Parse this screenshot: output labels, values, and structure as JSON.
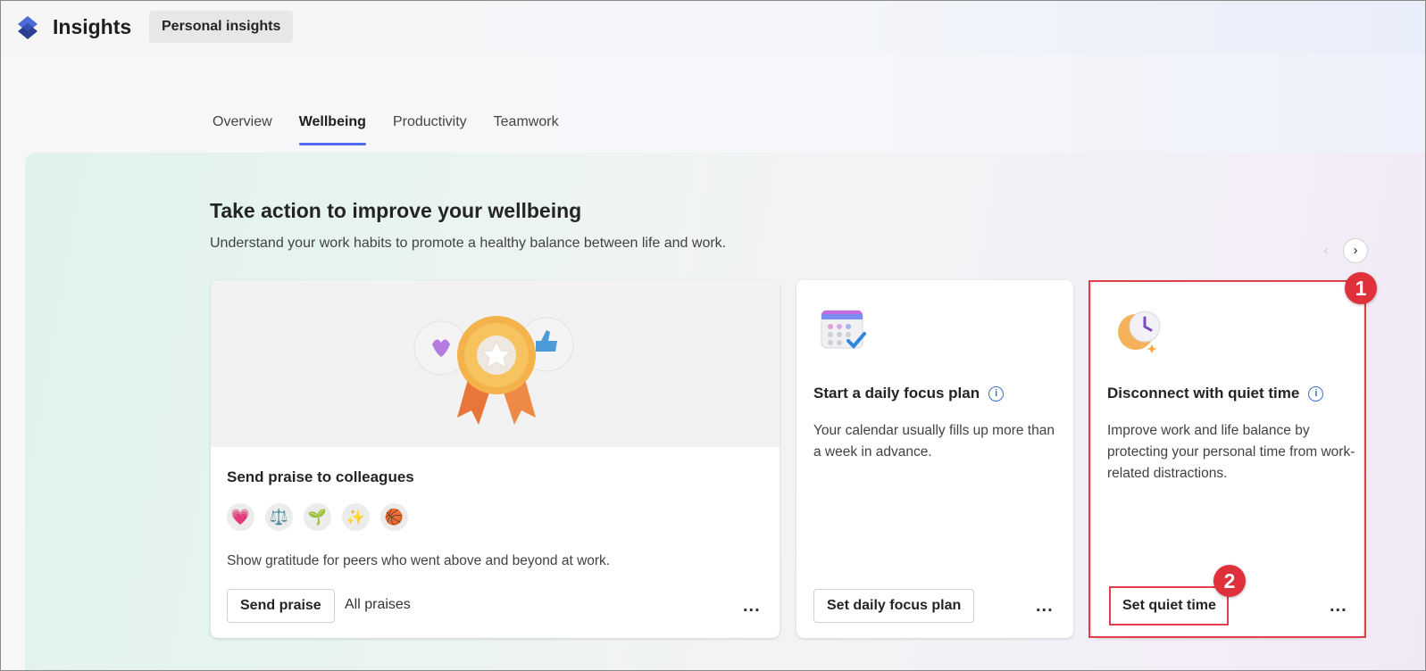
{
  "app": {
    "title": "Insights",
    "section_pill": "Personal insights"
  },
  "tabs": [
    {
      "label": "Overview",
      "active": false
    },
    {
      "label": "Wellbeing",
      "active": true
    },
    {
      "label": "Productivity",
      "active": false
    },
    {
      "label": "Teamwork",
      "active": false
    }
  ],
  "main": {
    "heading": "Take action to improve your wellbeing",
    "subheading": "Understand your work habits to promote a healthy balance between life and work.",
    "carousel": {
      "prev_icon": "‹",
      "next_icon": "›"
    }
  },
  "cards": [
    {
      "title": "Send praise to colleagues",
      "emojis": [
        "💗",
        "⚖️",
        "🌱",
        "✨",
        "🏀"
      ],
      "description": "Show gratitude for peers who went above and beyond at work.",
      "primary_button": "Send praise",
      "secondary_button": "All praises",
      "more": "..."
    },
    {
      "title": "Start a daily focus plan",
      "description": "Your calendar usually fills up more than a week in advance.",
      "primary_button": "Set daily focus plan",
      "more": "..."
    },
    {
      "title": "Disconnect with quiet time",
      "description": "Improve work and life balance by protecting your personal time from work-related distractions.",
      "primary_button": "Set quiet time",
      "more": "..."
    }
  ],
  "annotations": {
    "badge1": "1",
    "badge2": "2",
    "color": "#e0303c"
  },
  "colors": {
    "accent": "#4f6bed",
    "info": "#3a6fd8"
  }
}
